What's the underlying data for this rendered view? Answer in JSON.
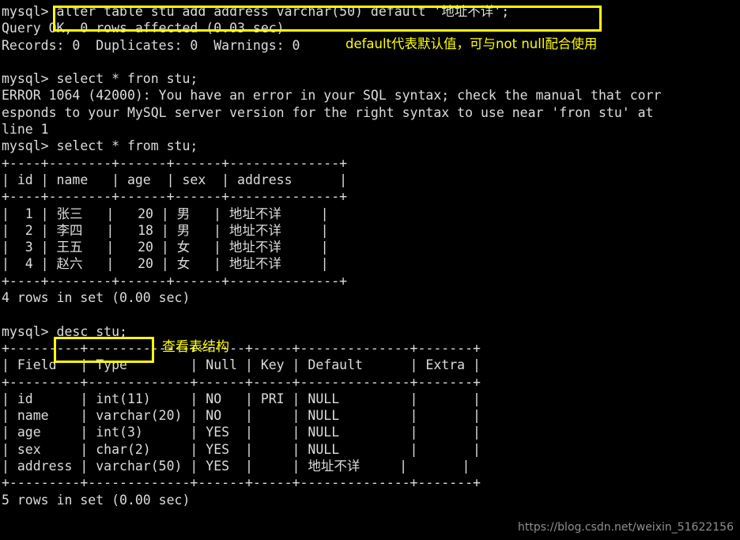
{
  "terminal": {
    "prompt": "mysql>",
    "colors": {
      "background": "#000000",
      "foreground": "#dcdcdc",
      "highlight": "#ffff00",
      "watermark": "#8f8f8f"
    },
    "lines": [
      "mysql> alter table stu add address varchar(50) default '地址不详';",
      "Query OK, 0 rows affected (0.03 sec)",
      "Records: 0  Duplicates: 0  Warnings: 0",
      "",
      "mysql> select * fron stu;",
      "ERROR 1064 (42000): You have an error in your SQL syntax; check the manual that corr",
      "esponds to your MySQL server version for the right syntax to use near 'fron stu' at",
      "line 1",
      "mysql> select * from stu;",
      "+----+--------+------+------+--------------+",
      "| id | name   | age  | sex  | address      |",
      "+----+--------+------+------+--------------+",
      "|  1 | 张三   |   20 | 男   | 地址不详     |",
      "|  2 | 李四   |   18 | 男   | 地址不详     |",
      "|  3 | 王五   |   20 | 女   | 地址不详     |",
      "|  4 | 赵六   |   20 | 女   | 地址不详     |",
      "+----+--------+------+------+--------------+",
      "4 rows in set (0.00 sec)",
      "",
      "mysql> desc stu;",
      "+---------+-------------+------+-----+--------------+-------+",
      "| Field   | Type        | Null | Key | Default      | Extra |",
      "+---------+-------------+------+-----+--------------+-------+",
      "| id      | int(11)     | NO   | PRI | NULL         |       |",
      "| name    | varchar(20) | NO   |     | NULL         |       |",
      "| age     | int(3)      | YES  |     | NULL         |       |",
      "| sex     | char(2)     | YES  |     | NULL         |       |",
      "| address | varchar(50) | YES  |     | 地址不详     |       |",
      "+---------+-------------+------+-----+--------------+-------+",
      "5 rows in set (0.00 sec)"
    ],
    "commands": {
      "alter_statement": "alter table stu add address varchar(50) default '地址不详';",
      "desc_statement": "desc stu;"
    },
    "annotations": {
      "default_note": "default代表默认值，可与not null配合使用",
      "desc_note": "查看表结构"
    },
    "results": {
      "alter_status": "Query OK, 0 rows affected (0.03 sec)",
      "alter_records": "Records: 0  Duplicates: 0  Warnings: 0",
      "error_code": "ERROR 1064 (42000)",
      "error_message": "You have an error in your SQL syntax; check the manual that corresponds to your MySQL server version for the right syntax to use near 'fron stu' at line 1",
      "select_rowcount": "4 rows in set (0.00 sec)",
      "desc_rowcount": "5 rows in set (0.00 sec)"
    },
    "select_table": {
      "headers": [
        "id",
        "name",
        "age",
        "sex",
        "address"
      ],
      "rows": [
        [
          "1",
          "张三",
          "20",
          "男",
          "地址不详"
        ],
        [
          "2",
          "李四",
          "18",
          "男",
          "地址不详"
        ],
        [
          "3",
          "王五",
          "20",
          "女",
          "地址不详"
        ],
        [
          "4",
          "赵六",
          "20",
          "女",
          "地址不详"
        ]
      ]
    },
    "desc_table": {
      "headers": [
        "Field",
        "Type",
        "Null",
        "Key",
        "Default",
        "Extra"
      ],
      "rows": [
        [
          "id",
          "int(11)",
          "NO",
          "PRI",
          "NULL",
          ""
        ],
        [
          "name",
          "varchar(20)",
          "NO",
          "",
          "NULL",
          ""
        ],
        [
          "age",
          "int(3)",
          "YES",
          "",
          "NULL",
          ""
        ],
        [
          "sex",
          "char(2)",
          "YES",
          "",
          "NULL",
          ""
        ],
        [
          "address",
          "varchar(50)",
          "YES",
          "",
          "地址不详",
          ""
        ]
      ]
    },
    "watermark": "https://blog.csdn.net/weixin_51622156"
  }
}
